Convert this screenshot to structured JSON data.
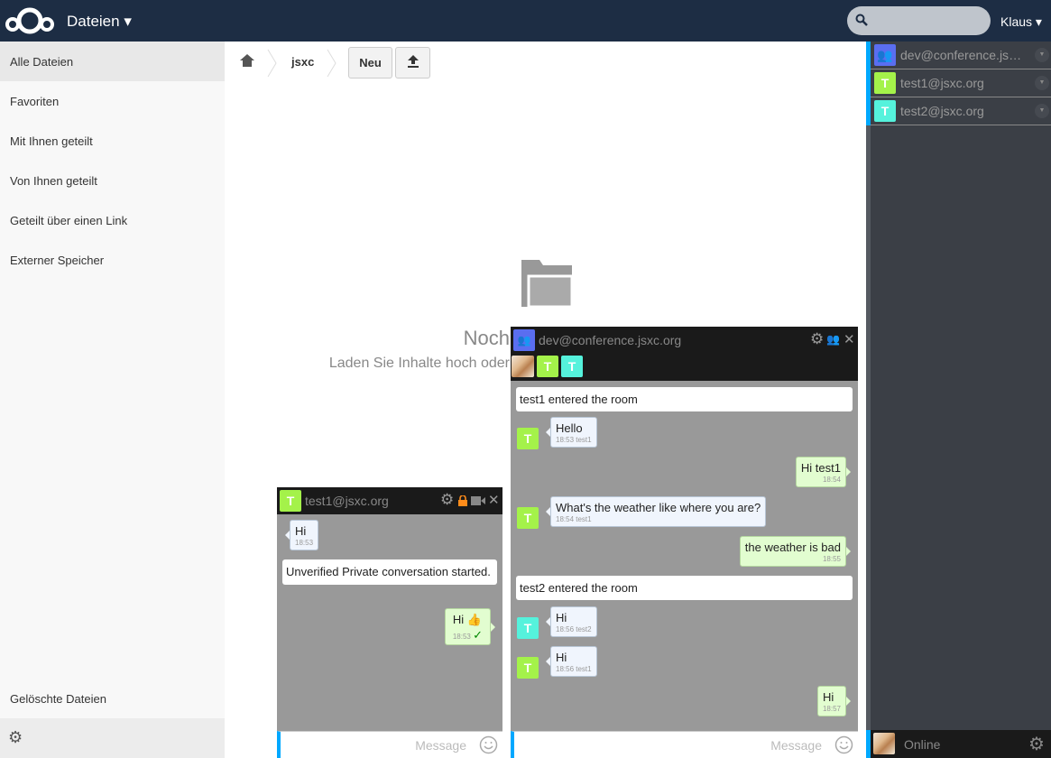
{
  "header": {
    "app_name": "Dateien ▾",
    "search_placeholder": "",
    "user": "Klaus ▾"
  },
  "sidebar": {
    "items": [
      {
        "label": "Alle Dateien",
        "active": true
      },
      {
        "label": "Favoriten"
      },
      {
        "label": "Mit Ihnen geteilt"
      },
      {
        "label": "Von Ihnen geteilt"
      },
      {
        "label": "Geteilt über einen Link"
      },
      {
        "label": "Externer Speicher"
      }
    ],
    "trash": "Gelöschte Dateien"
  },
  "breadcrumb": {
    "folder": "jsxc"
  },
  "toolbar": {
    "new_label": "Neu"
  },
  "empty": {
    "title": "Noch",
    "subtitle": "Laden Sie Inhalte hoch oder"
  },
  "colors": {
    "header": "#1d2d44",
    "accent": "#00a8ff",
    "group": "#5a6ef0",
    "test1": "#a4f24a",
    "test2": "#55f2dc",
    "lock": "#ff8c1a"
  },
  "roster": {
    "items": [
      {
        "name": "dev@conference.jsxc.org",
        "display": "dev@conference.jsxc....",
        "icon": "group-icon"
      },
      {
        "name": "test1@jsxc.org",
        "initial": "T"
      },
      {
        "name": "test2@jsxc.org",
        "initial": "T"
      }
    ],
    "status": "Online"
  },
  "chat1": {
    "title": "test1@jsxc.org",
    "initial": "T",
    "placeholder": "Message",
    "messages": [
      {
        "type": "in",
        "text": "Hi",
        "time": "18:53"
      },
      {
        "type": "sys",
        "text": "Unverified Private conversation started."
      },
      {
        "type": "out",
        "text": "Hi",
        "emoji": "👍",
        "time": "18:53",
        "check": "✓"
      }
    ]
  },
  "chat2": {
    "title": "dev@conference.jsxc.org",
    "placeholder": "Message",
    "members": [
      "T",
      "T"
    ],
    "messages": [
      {
        "type": "sys",
        "text": "test1 entered the room"
      },
      {
        "type": "in",
        "text": "Hello",
        "time": "18:53 test1",
        "initial": "T"
      },
      {
        "type": "out",
        "text": "Hi test1",
        "time": "18:54"
      },
      {
        "type": "in",
        "text": "What's the weather like where you are?",
        "time": "18:54 test1",
        "initial": "T"
      },
      {
        "type": "out",
        "text": "the weather is bad",
        "time": "18:55"
      },
      {
        "type": "sys",
        "text": "test2 entered the room"
      },
      {
        "type": "in",
        "text": "Hi",
        "time": "18:56 test2",
        "initial": "T"
      },
      {
        "type": "in",
        "text": "Hi",
        "time": "18:56 test1",
        "initial": "T"
      },
      {
        "type": "out",
        "text": "Hi",
        "time": "18:57"
      }
    ]
  }
}
